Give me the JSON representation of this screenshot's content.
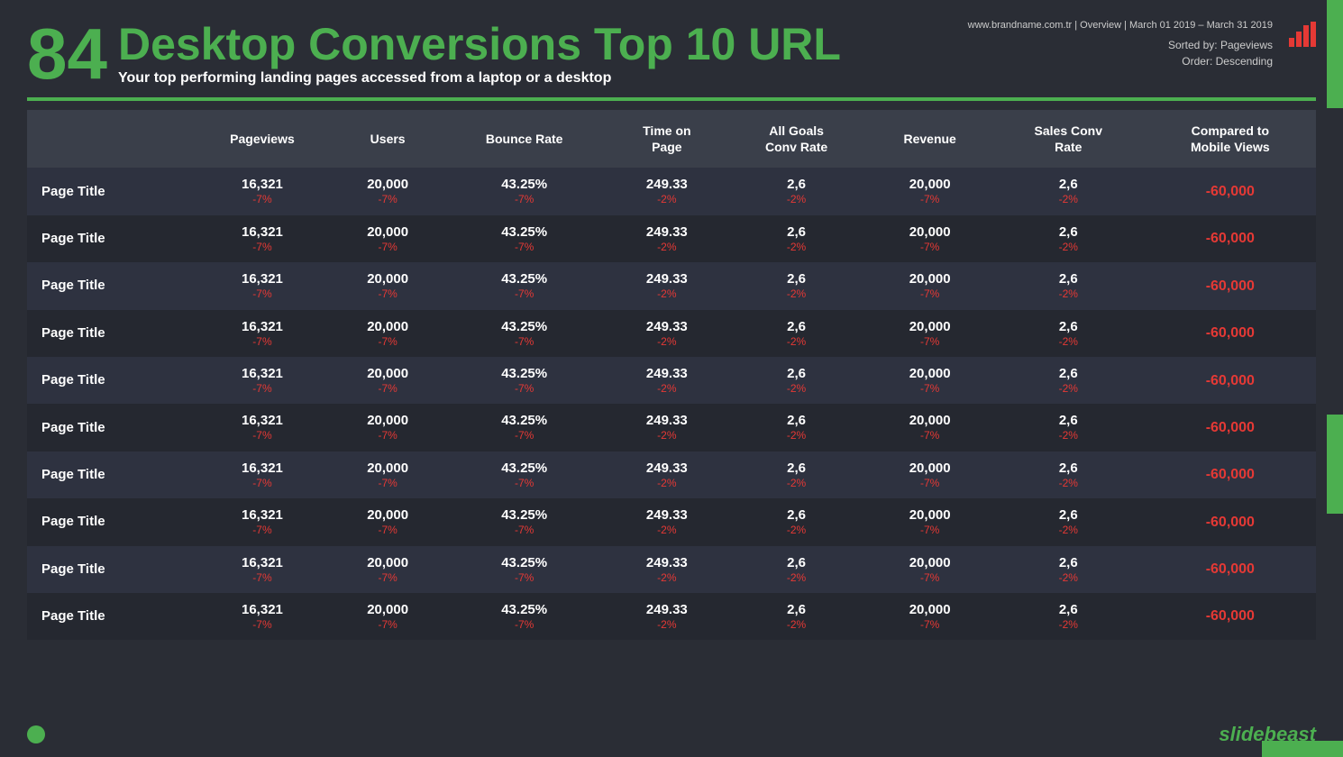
{
  "header": {
    "big_number": "84",
    "title": "Desktop Conversions Top 10 URL",
    "subtitle": "Your top performing landing pages accessed from a laptop or a desktop",
    "website_info": "www.brandname.com.tr | Overview | March 01 2019 – March 31 2019",
    "sort_label": "Sorted by: Pageviews",
    "order_label": "Order: Descending"
  },
  "table": {
    "columns": [
      {
        "label": "",
        "key": "page_title"
      },
      {
        "label": "Pageviews",
        "key": "pageviews"
      },
      {
        "label": "Users",
        "key": "users"
      },
      {
        "label": "Bounce Rate",
        "key": "bounce_rate"
      },
      {
        "label": "Time on Page",
        "key": "time_on_page"
      },
      {
        "label": "All Goals Conv Rate",
        "key": "goals_conv_rate"
      },
      {
        "label": "Revenue",
        "key": "revenue"
      },
      {
        "label": "Sales Conv Rate",
        "key": "sales_conv_rate"
      },
      {
        "label": "Compared to Mobile Views",
        "key": "compared_mobile"
      }
    ],
    "rows": [
      {
        "page_title": "Page Title",
        "pageviews": "16,321",
        "pageviews_change": "-7%",
        "users": "20,000",
        "users_change": "-7%",
        "bounce_rate": "43.25%",
        "bounce_rate_change": "-7%",
        "time_on_page": "249.33",
        "time_on_page_change": "-2%",
        "goals_conv_rate": "2,6",
        "goals_conv_rate_change": "-2%",
        "revenue": "20,000",
        "revenue_change": "-7%",
        "sales_conv_rate": "2,6",
        "sales_conv_rate_change": "-2%",
        "compared_mobile": "-60,000"
      },
      {
        "page_title": "Page Title",
        "pageviews": "16,321",
        "pageviews_change": "-7%",
        "users": "20,000",
        "users_change": "-7%",
        "bounce_rate": "43.25%",
        "bounce_rate_change": "-7%",
        "time_on_page": "249.33",
        "time_on_page_change": "-2%",
        "goals_conv_rate": "2,6",
        "goals_conv_rate_change": "-2%",
        "revenue": "20,000",
        "revenue_change": "-7%",
        "sales_conv_rate": "2,6",
        "sales_conv_rate_change": "-2%",
        "compared_mobile": "-60,000"
      },
      {
        "page_title": "Page Title",
        "pageviews": "16,321",
        "pageviews_change": "-7%",
        "users": "20,000",
        "users_change": "-7%",
        "bounce_rate": "43.25%",
        "bounce_rate_change": "-7%",
        "time_on_page": "249.33",
        "time_on_page_change": "-2%",
        "goals_conv_rate": "2,6",
        "goals_conv_rate_change": "-2%",
        "revenue": "20,000",
        "revenue_change": "-7%",
        "sales_conv_rate": "2,6",
        "sales_conv_rate_change": "-2%",
        "compared_mobile": "-60,000"
      },
      {
        "page_title": "Page Title",
        "pageviews": "16,321",
        "pageviews_change": "-7%",
        "users": "20,000",
        "users_change": "-7%",
        "bounce_rate": "43.25%",
        "bounce_rate_change": "-7%",
        "time_on_page": "249.33",
        "time_on_page_change": "-2%",
        "goals_conv_rate": "2,6",
        "goals_conv_rate_change": "-2%",
        "revenue": "20,000",
        "revenue_change": "-7%",
        "sales_conv_rate": "2,6",
        "sales_conv_rate_change": "-2%",
        "compared_mobile": "-60,000"
      },
      {
        "page_title": "Page Title",
        "pageviews": "16,321",
        "pageviews_change": "-7%",
        "users": "20,000",
        "users_change": "-7%",
        "bounce_rate": "43.25%",
        "bounce_rate_change": "-7%",
        "time_on_page": "249.33",
        "time_on_page_change": "-2%",
        "goals_conv_rate": "2,6",
        "goals_conv_rate_change": "-2%",
        "revenue": "20,000",
        "revenue_change": "-7%",
        "sales_conv_rate": "2,6",
        "sales_conv_rate_change": "-2%",
        "compared_mobile": "-60,000"
      },
      {
        "page_title": "Page Title",
        "pageviews": "16,321",
        "pageviews_change": "-7%",
        "users": "20,000",
        "users_change": "-7%",
        "bounce_rate": "43.25%",
        "bounce_rate_change": "-7%",
        "time_on_page": "249.33",
        "time_on_page_change": "-2%",
        "goals_conv_rate": "2,6",
        "goals_conv_rate_change": "-2%",
        "revenue": "20,000",
        "revenue_change": "-7%",
        "sales_conv_rate": "2,6",
        "sales_conv_rate_change": "-2%",
        "compared_mobile": "-60,000"
      },
      {
        "page_title": "Page Title",
        "pageviews": "16,321",
        "pageviews_change": "-7%",
        "users": "20,000",
        "users_change": "-7%",
        "bounce_rate": "43.25%",
        "bounce_rate_change": "-7%",
        "time_on_page": "249.33",
        "time_on_page_change": "-2%",
        "goals_conv_rate": "2,6",
        "goals_conv_rate_change": "-2%",
        "revenue": "20,000",
        "revenue_change": "-7%",
        "sales_conv_rate": "2,6",
        "sales_conv_rate_change": "-2%",
        "compared_mobile": "-60,000"
      },
      {
        "page_title": "Page Title",
        "pageviews": "16,321",
        "pageviews_change": "-7%",
        "users": "20,000",
        "users_change": "-7%",
        "bounce_rate": "43.25%",
        "bounce_rate_change": "-7%",
        "time_on_page": "249.33",
        "time_on_page_change": "-2%",
        "goals_conv_rate": "2,6",
        "goals_conv_rate_change": "-2%",
        "revenue": "20,000",
        "revenue_change": "-7%",
        "sales_conv_rate": "2,6",
        "sales_conv_rate_change": "-2%",
        "compared_mobile": "-60,000"
      },
      {
        "page_title": "Page Title",
        "pageviews": "16,321",
        "pageviews_change": "-7%",
        "users": "20,000",
        "users_change": "-7%",
        "bounce_rate": "43.25%",
        "bounce_rate_change": "-7%",
        "time_on_page": "249.33",
        "time_on_page_change": "-2%",
        "goals_conv_rate": "2,6",
        "goals_conv_rate_change": "-2%",
        "revenue": "20,000",
        "revenue_change": "-7%",
        "sales_conv_rate": "2,6",
        "sales_conv_rate_change": "-2%",
        "compared_mobile": "-60,000"
      },
      {
        "page_title": "Page Title",
        "pageviews": "16,321",
        "pageviews_change": "-7%",
        "users": "20,000",
        "users_change": "-7%",
        "bounce_rate": "43.25%",
        "bounce_rate_change": "-7%",
        "time_on_page": "249.33",
        "time_on_page_change": "-2%",
        "goals_conv_rate": "2,6",
        "goals_conv_rate_change": "-2%",
        "revenue": "20,000",
        "revenue_change": "-7%",
        "sales_conv_rate": "2,6",
        "sales_conv_rate_change": "-2%",
        "compared_mobile": "-60,000"
      }
    ]
  },
  "footer": {
    "brand": "slidebeast"
  },
  "colors": {
    "green": "#4caf50",
    "red": "#e53935",
    "bg_dark": "#2a2d35",
    "bg_header": "#3a3f4a",
    "bg_row_odd": "#2e3240",
    "bg_row_even": "#252830"
  }
}
